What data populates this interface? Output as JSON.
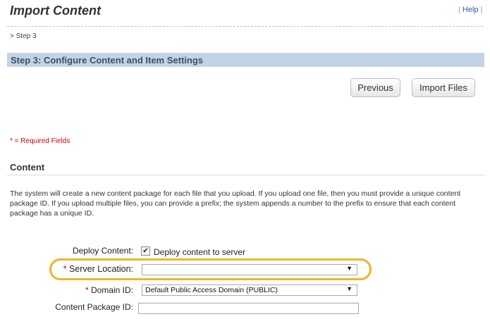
{
  "header": {
    "title": "Import Content",
    "help_separator_left": "|",
    "help_label": "Help",
    "help_separator_right": "|"
  },
  "breadcrumb": {
    "text": "> Step 3"
  },
  "step_bar": {
    "title": "Step 3: Configure Content and Item Settings"
  },
  "buttons": {
    "previous": "Previous",
    "import_files": "Import Files"
  },
  "required_note": "* = Required Fields",
  "content_section": {
    "heading": "Content",
    "description": "The system will create a new content package for each file that you upload. If you upload one file, then you must provide a unique content package ID. If you upload multiple files, you can provide a prefix; the system appends a number to the prefix to ensure that each content package has a unique ID."
  },
  "form": {
    "deploy_content": {
      "label": "Deploy Content:",
      "checked": true,
      "checkbox_label": "Deploy content to server"
    },
    "server_location": {
      "required_mark": "*",
      "label": "Server Location:",
      "value": "",
      "highlighted": true
    },
    "domain_id": {
      "required_mark": "*",
      "label": "Domain ID:",
      "value": "Default Public Access Domain (PUBLIC)"
    },
    "content_package_id": {
      "label": "Content Package ID:",
      "value": ""
    }
  },
  "colors": {
    "step_bar_bg": "#c3d3e6",
    "required_red": "#d00000",
    "highlight_ring": "#f0b32d",
    "link_blue": "#2a5aa0"
  },
  "icons": {
    "checkbox": "checkmark-icon",
    "dropdown": "chevron-down-icon"
  }
}
